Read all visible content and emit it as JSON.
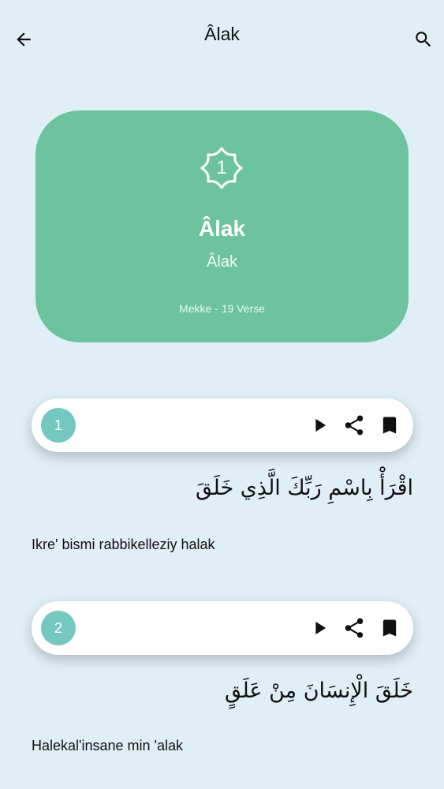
{
  "appbar": {
    "title": "Âlak",
    "back_icon": "arrow-left-icon",
    "search_icon": "search-icon"
  },
  "header_card": {
    "number": "1",
    "name": "Âlak",
    "translation": "Âlak",
    "meta": "Mekke - 19 Verse",
    "color": "#6cc39e"
  },
  "verses": [
    {
      "number": "1",
      "arabic": "اقْرَأْ بِاسْمِ رَبِّكَ الَّذِي خَلَقَ",
      "transliteration": "Ikre' bismi rabbikelleziy halak"
    },
    {
      "number": "2",
      "arabic": "خَلَقَ الْإِنسَانَ مِنْ عَلَقٍ",
      "transliteration": "Halekal'insane min 'alak"
    }
  ],
  "colors": {
    "background": "#e0eef6",
    "verse_number_bg": "#74c8c0"
  }
}
